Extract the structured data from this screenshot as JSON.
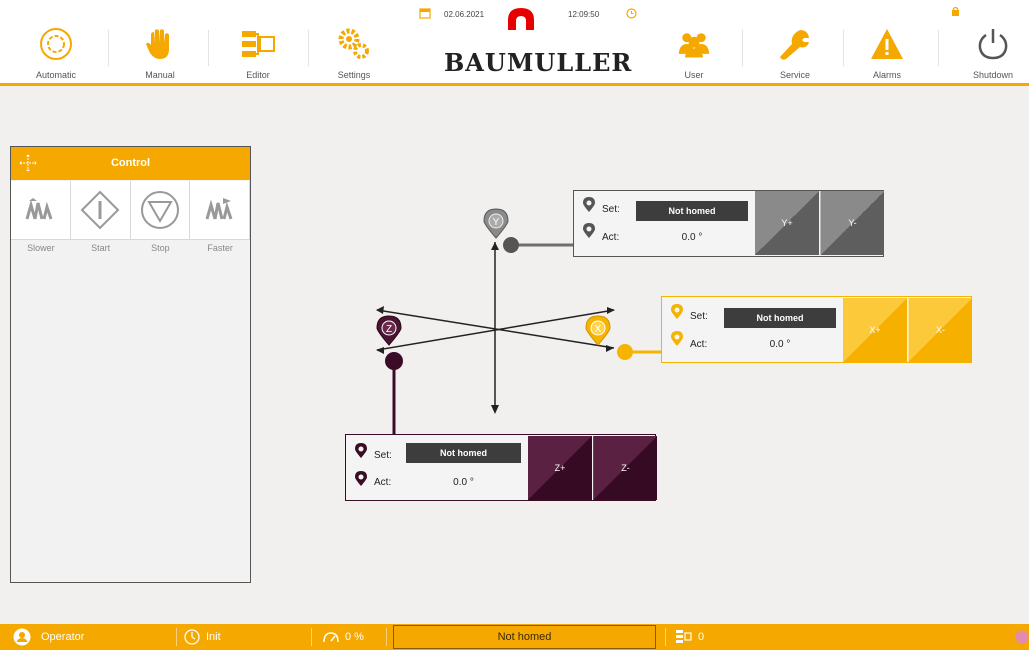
{
  "toolbar": {
    "items": [
      {
        "label": "Automatic",
        "icon": "automatic-icon"
      },
      {
        "label": "Manual",
        "icon": "hand-icon"
      },
      {
        "label": "Editor",
        "icon": "editor-icon"
      },
      {
        "label": "Settings",
        "icon": "gears-icon"
      },
      {
        "label": "User",
        "icon": "users-icon"
      },
      {
        "label": "Service",
        "icon": "wrench-icon"
      },
      {
        "label": "Alarms",
        "icon": "warning-icon"
      },
      {
        "label": "Shutdown",
        "icon": "power-icon"
      }
    ],
    "date": "02.06.2021",
    "time": "12:09:50",
    "brand": "BAUMULLER"
  },
  "control": {
    "title": "Control",
    "buttons": [
      {
        "label": "Slower",
        "icon": "slower-icon"
      },
      {
        "label": "Start",
        "icon": "start-icon"
      },
      {
        "label": "Stop",
        "icon": "stop-icon"
      },
      {
        "label": "Faster",
        "icon": "faster-icon"
      }
    ]
  },
  "axes": {
    "y": {
      "marker": "Y",
      "set_label": "Set:",
      "set_value": "Not homed",
      "act_label": "Act:",
      "act_value": "0.0 °",
      "plus": "Y+",
      "minus": "Y-"
    },
    "x": {
      "marker": "X",
      "set_label": "Set:",
      "set_value": "Not homed",
      "act_label": "Act:",
      "act_value": "0.0 °",
      "plus": "X+",
      "minus": "X-"
    },
    "z": {
      "marker": "Z",
      "set_label": "Set:",
      "set_value": "Not homed",
      "act_label": "Act:",
      "act_value": "0.0 °",
      "plus": "Z+",
      "minus": "Z-"
    }
  },
  "colors": {
    "accent": "#f5a800",
    "y_axis": "#6e6e6e",
    "x_axis": "#f5b400",
    "z_axis": "#3a0c26"
  },
  "status": {
    "role": "Operator",
    "state": "Init",
    "speed": "0 %",
    "message": "Not homed",
    "counter": "0"
  }
}
